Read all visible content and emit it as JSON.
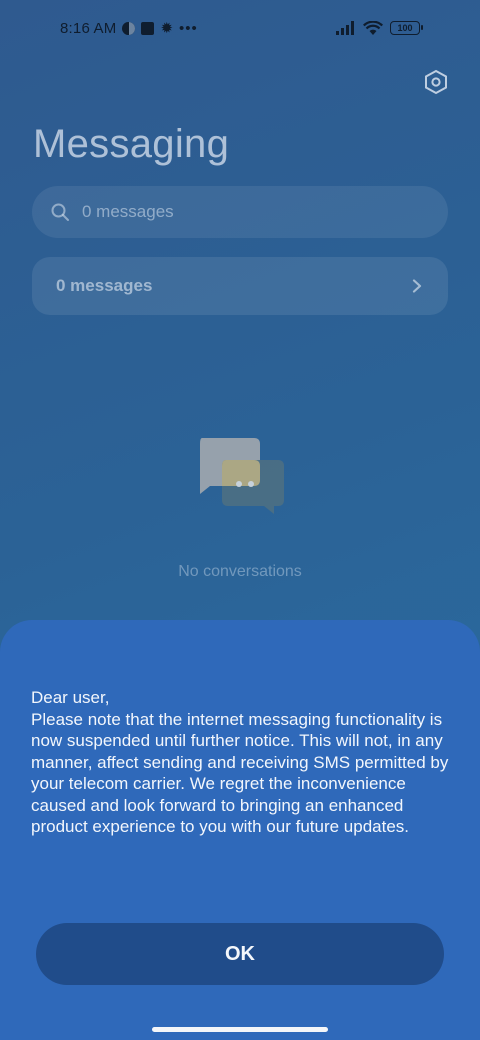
{
  "status_bar": {
    "time": "8:16 AM",
    "icons": [
      "half-circle-icon",
      "square-icon",
      "gear-icon",
      "more-dots-icon"
    ],
    "right_icons": [
      "signal-icon",
      "wifi-icon"
    ],
    "battery_level": "100"
  },
  "app": {
    "title": "Messaging",
    "settings_icon": "hexagon-settings-icon",
    "search": {
      "placeholder": "0 messages",
      "icon": "search-icon"
    },
    "messages_card": {
      "label": "0 messages",
      "icon": "chevron-right-icon"
    },
    "empty_state": {
      "text": "No conversations",
      "icon": "chat-bubbles-icon"
    }
  },
  "dialog": {
    "message": "Dear user,\nPlease note that the internet messaging functionality is now suspended until further notice. This will not, in any manner, affect sending and receiving SMS permitted by your telecom carrier. We regret the inconvenience caused and look forward to bringing an enhanced product experience to you with our future updates.",
    "ok_label": "OK"
  },
  "colors": {
    "background": "#2b6296",
    "dialog": "#2f69ba",
    "ok_button": "#204c8a"
  }
}
